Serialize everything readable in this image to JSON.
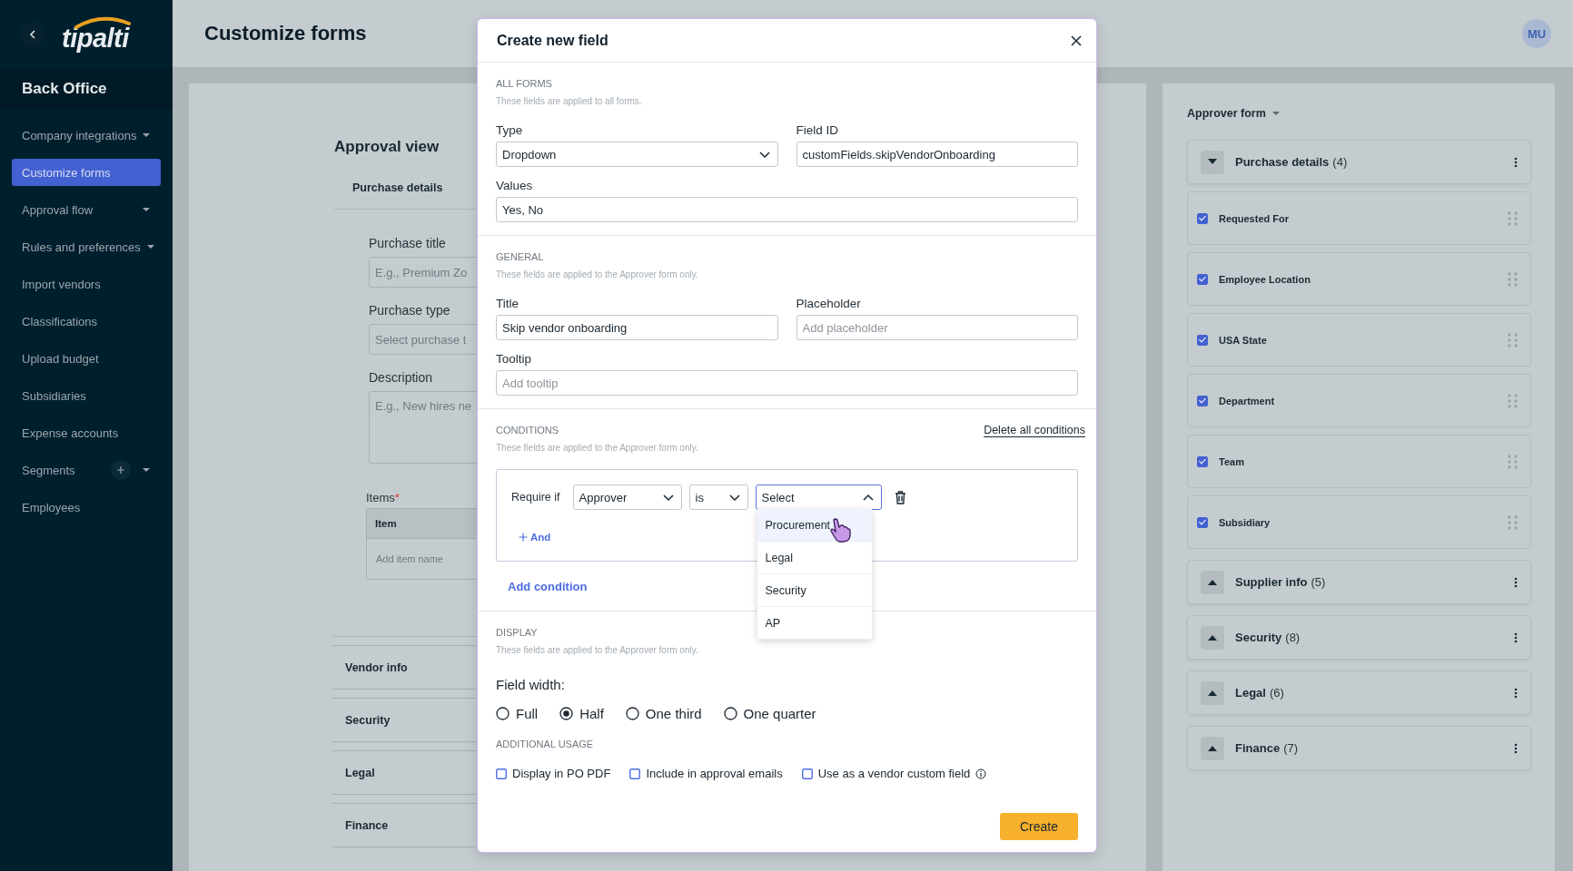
{
  "sidebar": {
    "logo": "tipalti",
    "section": "Back Office",
    "items": [
      {
        "label": "Company integrations",
        "selected": false,
        "expandable": true,
        "addable": false
      },
      {
        "label": "Customize forms",
        "selected": true,
        "expandable": false,
        "addable": false
      },
      {
        "label": "Approval flow",
        "selected": false,
        "expandable": true,
        "addable": false
      },
      {
        "label": "Rules and preferences",
        "selected": false,
        "expandable": true,
        "addable": false
      },
      {
        "label": "Import vendors",
        "selected": false,
        "expandable": false,
        "addable": false
      },
      {
        "label": "Classifications",
        "selected": false,
        "expandable": false,
        "addable": false
      },
      {
        "label": "Upload budget",
        "selected": false,
        "expandable": false,
        "addable": false
      },
      {
        "label": "Subsidiaries",
        "selected": false,
        "expandable": false,
        "addable": false
      },
      {
        "label": "Expense accounts",
        "selected": false,
        "expandable": false,
        "addable": false
      },
      {
        "label": "Segments",
        "selected": false,
        "expandable": true,
        "addable": true
      },
      {
        "label": "Employees",
        "selected": false,
        "expandable": false,
        "addable": false
      }
    ]
  },
  "header": {
    "title": "Customize forms",
    "avatar": "MU"
  },
  "approval_view": {
    "title": "Approval view",
    "tab": "Purchase details",
    "fields": [
      {
        "label": "Purchase title",
        "placeholder": "E.g., Premium Zo",
        "kind": "input"
      },
      {
        "label": "Purchase type",
        "placeholder": "Select purchase t",
        "kind": "input"
      },
      {
        "label": "Description",
        "placeholder": "E.g., New hires ne",
        "kind": "textarea"
      }
    ],
    "items": {
      "label": "Items",
      "required_mark": "*",
      "column": "Item",
      "placeholder": "Add item name"
    },
    "sections": [
      "Vendor info",
      "Security",
      "Legal",
      "Finance"
    ]
  },
  "right_panel": {
    "title": "Approver form",
    "groups": [
      {
        "title": "Purchase details",
        "count": "(4)",
        "expanded": true,
        "fields": [
          {
            "label": "Requested For",
            "checked": true
          },
          {
            "label": "Employee Location",
            "checked": true
          },
          {
            "label": "USA State",
            "checked": true
          },
          {
            "label": "Department",
            "checked": true
          },
          {
            "label": "Team",
            "checked": true
          },
          {
            "label": "Subsidiary",
            "checked": true
          }
        ]
      },
      {
        "title": "Supplier info",
        "count": "(5)",
        "expanded": false
      },
      {
        "title": "Security",
        "count": "(8)",
        "expanded": false
      },
      {
        "title": "Legal",
        "count": "(6)",
        "expanded": false
      },
      {
        "title": "Finance",
        "count": "(7)",
        "expanded": false
      }
    ]
  },
  "modal": {
    "title": "Create new field",
    "all_forms": {
      "heading": "ALL FORMS",
      "description": "These fields are applied to all forms.",
      "type": {
        "label": "Type",
        "value": "Dropdown"
      },
      "field_id": {
        "label": "Field ID",
        "value": "customFields.skipVendorOnboarding"
      },
      "values": {
        "label": "Values",
        "value": "Yes, No"
      }
    },
    "general": {
      "heading": "GENERAL",
      "description": "These fields are applied to the Approver form only.",
      "title": {
        "label": "Title",
        "value": "Skip vendor onboarding"
      },
      "placeholder": {
        "label": "Placeholder",
        "placeholder": "Add placeholder"
      },
      "tooltip": {
        "label": "Tooltip",
        "placeholder": "Add tooltip"
      }
    },
    "conditions": {
      "heading": "CONDITIONS",
      "description": "These fields are applied to the Approver form only.",
      "delete_all": "Delete all conditions",
      "rows": [
        {
          "prefix": "Require if",
          "attribute": "Approver",
          "operator": "is",
          "value": "Select",
          "open": true,
          "add_and": "And",
          "options": [
            {
              "label": "Procurement",
              "highlighted": true
            },
            {
              "label": "Legal",
              "highlighted": false
            },
            {
              "label": "Security",
              "highlighted": false
            },
            {
              "label": "AP",
              "highlighted": false
            }
          ]
        }
      ],
      "add_condition": "Add condition"
    },
    "display": {
      "heading": "DISPLAY",
      "description": "These fields are applied to the Approver form only.",
      "width_label": "Field width:",
      "width_options": [
        {
          "label": "Full",
          "selected": false
        },
        {
          "label": "Half",
          "selected": true
        },
        {
          "label": "One third",
          "selected": false
        },
        {
          "label": "One quarter",
          "selected": false
        }
      ],
      "usage_heading": "ADDITIONAL USAGE",
      "usage_options": [
        {
          "label": "Display in PO PDF",
          "checked": false,
          "info": false
        },
        {
          "label": "Include in approval emails",
          "checked": false,
          "info": false
        },
        {
          "label": "Use as a vendor custom field",
          "checked": false,
          "info": true
        }
      ]
    },
    "create": "Create"
  }
}
